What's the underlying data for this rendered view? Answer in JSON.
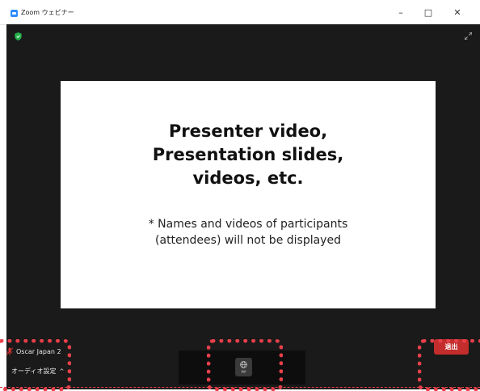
{
  "window": {
    "title": "Zoom ウェビナー",
    "minimize_glyph": "–",
    "maximize_glyph": "□",
    "close_glyph": "✕"
  },
  "slide": {
    "heading_lines": [
      "Presenter video,",
      "Presentation slides,",
      "videos, etc."
    ],
    "note_lines": [
      "* Names and videos of participants",
      "(attendees) will not be displayed"
    ]
  },
  "participant": {
    "name": "Oscar Japan 2",
    "mic_state_icon": "mic-muted-icon"
  },
  "audio": {
    "label": "オーディオ設定",
    "caret": "^"
  },
  "toolbar": {
    "interpretation_label": "通訳",
    "interpretation_icon": "globe-icon"
  },
  "leave": {
    "label": "退出"
  },
  "colors": {
    "meeting_bg": "#1a1a1a",
    "leave_red": "#c32d2b",
    "highlight_red": "#e8404b",
    "security_green": "#24b24b",
    "zoom_blue": "#2d8cff"
  }
}
